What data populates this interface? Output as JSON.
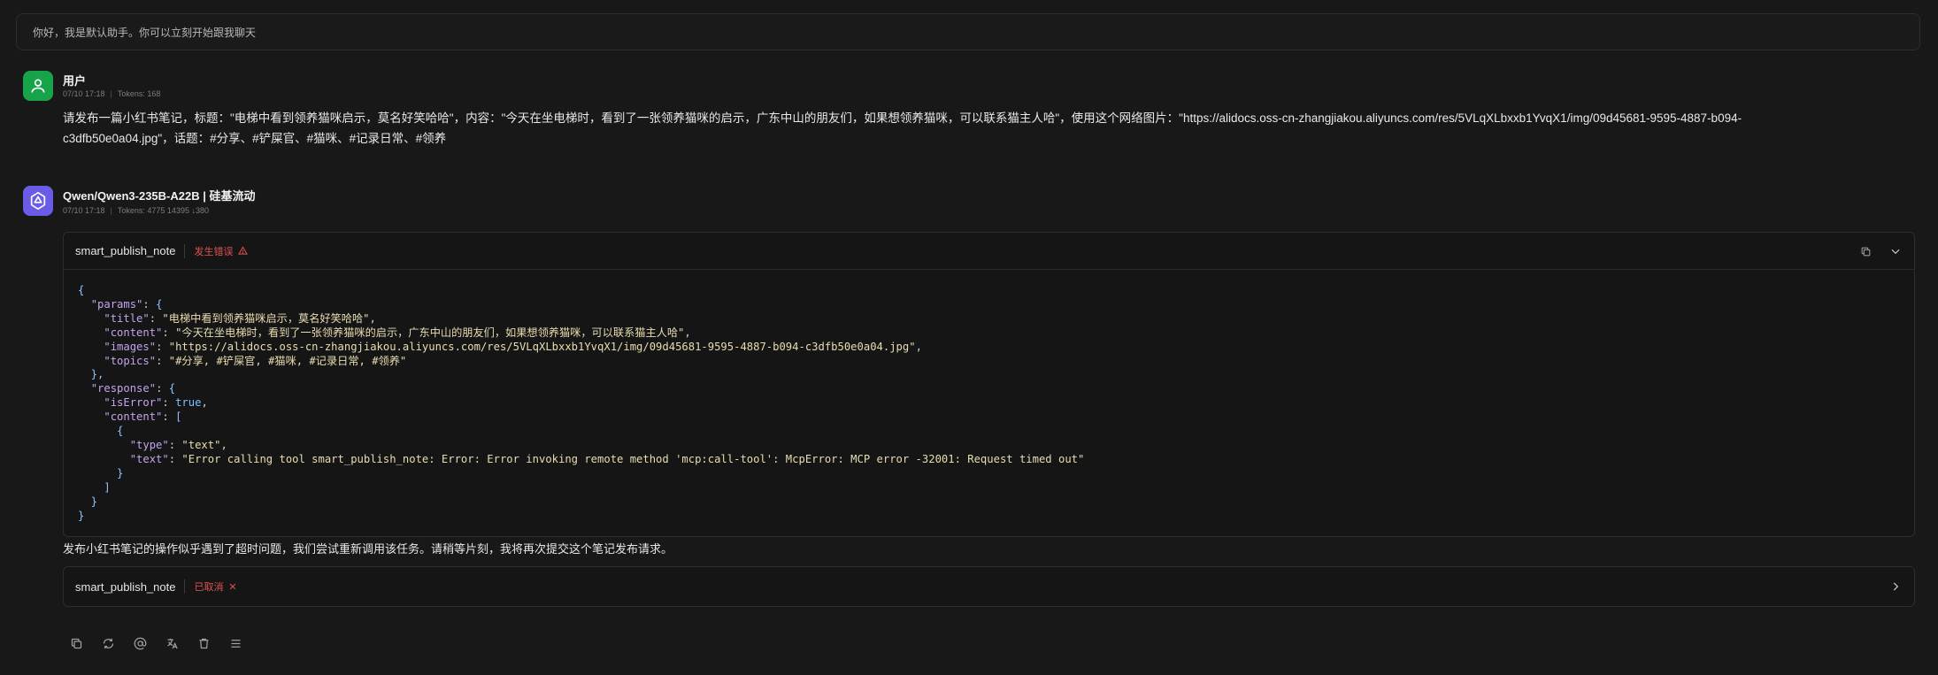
{
  "system_message": "你好，我是默认助手。你可以立刻开始跟我聊天",
  "user_msg": {
    "name": "用户",
    "timestamp": "07/10 17:18",
    "tokens": "Tokens: 168",
    "text_line1": "请发布一篇小红书笔记，标题：\"电梯中看到领养猫咪启示，莫名好笑哈哈\"，内容：\"今天在坐电梯时，看到了一张领养猫咪的启示，广东中山的朋友们，如果想领养猫咪，可以联系猫主人哈\"，使用这个网络图片：\"https://alidocs.oss-cn-zhangjiakou.aliyuncs.com/res/5VLqXLbxxb1YvqX1/img/09d45681-9595-4887-b094-",
    "text_line2": "c3dfb50e0a04.jpg\"，话题：#分享、#铲屎官、#猫咪、#记录日常、#领养"
  },
  "assistant_msg": {
    "name": "Qwen/Qwen3-235B-A22B | 硅基流动",
    "timestamp": "07/10 17:18",
    "tokens": "Tokens: 4775 14395 ↓380",
    "tool_call_1": {
      "name": "smart_publish_note",
      "status": "发生错误",
      "code": {
        "k_params": "\"params\"",
        "k_title": "\"title\"",
        "v_title": "\"电梯中看到领养猫咪启示，莫名好笑哈哈\"",
        "k_content": "\"content\"",
        "v_content": "\"今天在坐电梯时，看到了一张领养猫咪的启示，广东中山的朋友们，如果想领养猫咪，可以联系猫主人哈\"",
        "k_images": "\"images\"",
        "v_images": "\"https://alidocs.oss-cn-zhangjiakou.aliyuncs.com/res/5VLqXLbxxb1YvqX1/img/09d45681-9595-4887-b094-c3dfb50e0a04.jpg\"",
        "k_topics": "\"topics\"",
        "v_topics": "\"#分享, #铲屎官, #猫咪, #记录日常, #领养\"",
        "k_response": "\"response\"",
        "k_isError": "\"isError\"",
        "v_isError": "true",
        "k_content2": "\"content\"",
        "k_type": "\"type\"",
        "v_type": "\"text\"",
        "k_text": "\"text\"",
        "v_text": "\"Error calling tool smart_publish_note: Error: Error invoking remote method 'mcp:call-tool': McpError: MCP error -32001: Request timed out\""
      }
    },
    "reply_text": "发布小红书笔记的操作似乎遇到了超时问题，我们尝试重新调用该任务。请稍等片刻，我将再次提交这个笔记发布请求。",
    "tool_call_2": {
      "name": "smart_publish_note",
      "status": "已取消"
    }
  },
  "icons": [
    "user-icon",
    "qwen-logo-icon",
    "warning-icon",
    "copy-icon",
    "chevron-down-icon",
    "close-icon",
    "chevron-right-icon",
    "refresh-icon",
    "mention-icon",
    "translate-icon",
    "trash-icon",
    "menu-icon"
  ],
  "colors": {
    "background": "#181818",
    "user_avatar": "#16a34a",
    "bot_avatar": "#6b5ce7",
    "error": "#e05252"
  }
}
